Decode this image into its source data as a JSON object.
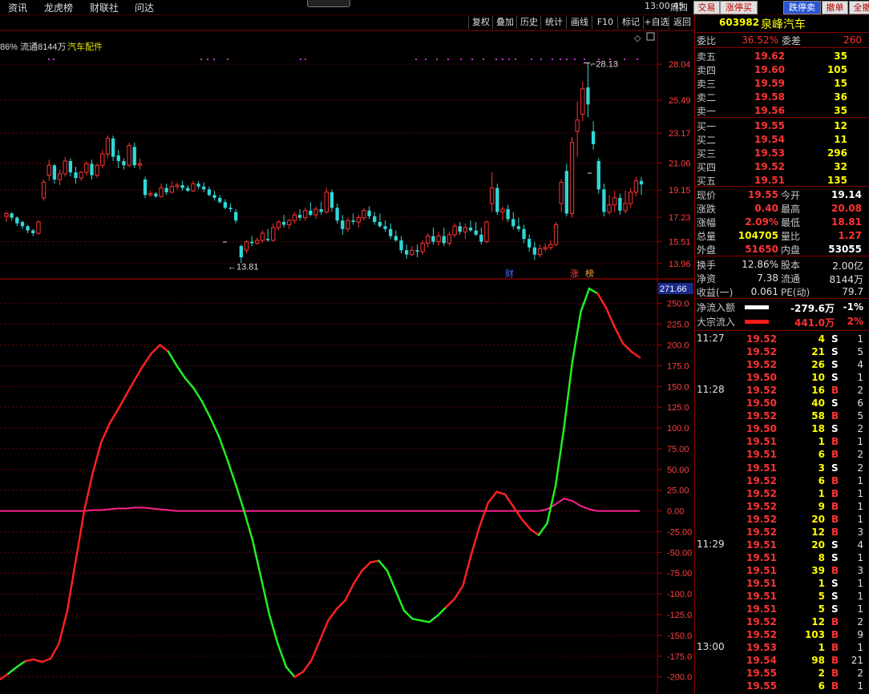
{
  "menu": [
    "资讯",
    "龙虎榜",
    "财联社",
    "问达"
  ],
  "clock": "13:00:45",
  "weekday": "周四",
  "top_buttons": [
    {
      "label": "交易",
      "bg": "#e0e0e0",
      "fg": "#c00000"
    },
    {
      "label": "涨停买",
      "bg": "#e0e0e0",
      "fg": "#c00000"
    },
    {
      "label": "跌停卖",
      "bg": "#2a55d4",
      "fg": "#ffffff"
    },
    {
      "label": "撤单",
      "bg": "#e0e0e0",
      "fg": "#c00000"
    },
    {
      "label": "全撤",
      "bg": "#e0e0e0",
      "fg": "#c00000"
    }
  ],
  "toolbar": [
    "复权",
    "叠加",
    "历史",
    "统计",
    "画线",
    "F10",
    "标记",
    "+自选",
    "返回"
  ],
  "chart_info": {
    "prefix": "86% 流通8144万",
    "sector": "汽车配件"
  },
  "price_axis": [
    "28.04",
    "25.49",
    "23.17",
    "21.06",
    "19.15",
    "17.23",
    "15.51",
    "13.96"
  ],
  "high_mark": "28.13",
  "low_mark": "13.81",
  "markers": [
    {
      "text": "财",
      "color": "#4a6cff"
    },
    {
      "text": "涨",
      "color": "#ff4040"
    },
    {
      "text": "榜",
      "color": "#ff9a30"
    }
  ],
  "indicator_current": "271.66",
  "indicator_axis": [
    "250.0",
    "225.0",
    "200.0",
    "175.0",
    "150.0",
    "125.0",
    "100.0",
    "75.00",
    "50.00",
    "25.00",
    "0.00",
    "-25.00",
    "-50.00",
    "-75.00",
    "-100.0",
    "-125.0",
    "-150.0",
    "-175.0",
    "-200.0"
  ],
  "colors": {
    "up": "#ff3333",
    "down": "#30d8d8",
    "green_line": "#22ee22",
    "red_line": "#ff2020",
    "zero_line": "#ff2090",
    "grid": "#6a0000",
    "yellow": "#ffff00"
  },
  "stock": {
    "code": "603982",
    "name": "泉峰汽车"
  },
  "weibi": {
    "label1": "委比",
    "val1": "36.52%",
    "label2": "委差",
    "val2": "260"
  },
  "asks": [
    {
      "label": "卖五",
      "price": "19.62",
      "vol": "35"
    },
    {
      "label": "卖四",
      "price": "19.60",
      "vol": "105"
    },
    {
      "label": "卖三",
      "price": "19.59",
      "vol": "15"
    },
    {
      "label": "卖二",
      "price": "19.58",
      "vol": "36"
    },
    {
      "label": "卖一",
      "price": "19.56",
      "vol": "35"
    }
  ],
  "bids": [
    {
      "label": "买一",
      "price": "19.55",
      "vol": "12"
    },
    {
      "label": "买二",
      "price": "19.54",
      "vol": "11"
    },
    {
      "label": "买三",
      "price": "19.53",
      "vol": "296"
    },
    {
      "label": "买四",
      "price": "19.52",
      "vol": "32"
    },
    {
      "label": "买五",
      "price": "19.51",
      "vol": "135"
    }
  ],
  "quote": [
    {
      "l1": "现价",
      "v1": "19.55",
      "c1": "#ff3333",
      "l2": "今开",
      "v2": "19.14",
      "c2": "#ffffff"
    },
    {
      "l1": "涨跌",
      "v1": "0.40",
      "c1": "#ff3333",
      "l2": "最高",
      "v2": "20.08",
      "c2": "#ff3333"
    },
    {
      "l1": "涨幅",
      "v1": "2.09%",
      "c1": "#ff3333",
      "l2": "最低",
      "v2": "18.81",
      "c2": "#ff3333"
    },
    {
      "l1": "总量",
      "v1": "104705",
      "c1": "#ffff00",
      "l2": "量比",
      "v2": "1.27",
      "c2": "#ff3333"
    },
    {
      "l1": "外盘",
      "v1": "51650",
      "c1": "#ff3333",
      "l2": "内盘",
      "v2": "53055",
      "c2": "#ffffff"
    }
  ],
  "stats": [
    {
      "l1": "换手",
      "v1": "12.86%",
      "l2": "股本",
      "v2": "2.00亿"
    },
    {
      "l1": "净资",
      "v1": "7.38",
      "l2": "流通",
      "v2": "8144万"
    },
    {
      "l1": "收益(一)",
      "v1": "0.061",
      "l2": "PE(动)",
      "v2": "79.7"
    }
  ],
  "flows": [
    {
      "label": "净流入额",
      "bar_color": "#ffffff",
      "value": "-279.6万",
      "pct": "-1%",
      "vcolor": "#ffffff"
    },
    {
      "label": "大宗流入",
      "bar_color": "#ff1a1a",
      "value": "441.0万",
      "pct": "2%",
      "vcolor": "#ff3333"
    }
  ],
  "ticks": [
    {
      "time": "11:27",
      "price": "19.52",
      "vol": "4",
      "bs": "S",
      "n": "1"
    },
    {
      "time": "",
      "price": "19.52",
      "vol": "21",
      "bs": "S",
      "n": "5"
    },
    {
      "time": "",
      "price": "19.52",
      "vol": "26",
      "bs": "S",
      "n": "4"
    },
    {
      "time": "",
      "price": "19.50",
      "vol": "10",
      "bs": "S",
      "n": "1"
    },
    {
      "time": "11:28",
      "price": "19.52",
      "vol": "16",
      "bs": "B",
      "n": "2"
    },
    {
      "time": "",
      "price": "19.50",
      "vol": "40",
      "bs": "S",
      "n": "6"
    },
    {
      "time": "",
      "price": "19.52",
      "vol": "58",
      "bs": "B",
      "n": "5"
    },
    {
      "time": "",
      "price": "19.50",
      "vol": "18",
      "bs": "S",
      "n": "2"
    },
    {
      "time": "",
      "price": "19.51",
      "vol": "1",
      "bs": "B",
      "n": "1"
    },
    {
      "time": "",
      "price": "19.51",
      "vol": "6",
      "bs": "B",
      "n": "2"
    },
    {
      "time": "",
      "price": "19.51",
      "vol": "3",
      "bs": "S",
      "n": "2"
    },
    {
      "time": "",
      "price": "19.52",
      "vol": "6",
      "bs": "B",
      "n": "1"
    },
    {
      "time": "",
      "price": "19.52",
      "vol": "1",
      "bs": "B",
      "n": "1"
    },
    {
      "time": "",
      "price": "19.52",
      "vol": "9",
      "bs": "B",
      "n": "1"
    },
    {
      "time": "",
      "price": "19.52",
      "vol": "20",
      "bs": "B",
      "n": "1"
    },
    {
      "time": "",
      "price": "19.52",
      "vol": "12",
      "bs": "B",
      "n": "3"
    },
    {
      "time": "11:29",
      "price": "19.51",
      "vol": "20",
      "bs": "S",
      "n": "4"
    },
    {
      "time": "",
      "price": "19.51",
      "vol": "8",
      "bs": "S",
      "n": "1"
    },
    {
      "time": "",
      "price": "19.51",
      "vol": "39",
      "bs": "B",
      "n": "3"
    },
    {
      "time": "",
      "price": "19.51",
      "vol": "1",
      "bs": "S",
      "n": "1"
    },
    {
      "time": "",
      "price": "19.51",
      "vol": "5",
      "bs": "S",
      "n": "1"
    },
    {
      "time": "",
      "price": "19.51",
      "vol": "5",
      "bs": "S",
      "n": "1"
    },
    {
      "time": "",
      "price": "19.52",
      "vol": "12",
      "bs": "B",
      "n": "2"
    },
    {
      "time": "",
      "price": "19.52",
      "vol": "103",
      "bs": "B",
      "n": "9"
    },
    {
      "time": "13:00",
      "price": "19.53",
      "vol": "1",
      "bs": "B",
      "n": "1"
    },
    {
      "time": "",
      "price": "19.54",
      "vol": "98",
      "bs": "B",
      "n": "21"
    },
    {
      "time": "",
      "price": "19.55",
      "vol": "2",
      "bs": "B",
      "n": "2"
    },
    {
      "time": "",
      "price": "19.55",
      "vol": "6",
      "bs": "B",
      "n": "1"
    }
  ],
  "chart_data": [
    {
      "type": "candlestick",
      "ylim": [
        13.5,
        28.5
      ],
      "candles": [
        [
          17.3,
          17.6,
          16.9,
          17.5
        ],
        [
          17.5,
          17.6,
          17.0,
          17.2
        ],
        [
          17.2,
          17.3,
          16.6,
          16.8
        ],
        [
          16.9,
          17.0,
          16.4,
          16.6
        ],
        [
          16.6,
          16.7,
          16.1,
          16.3
        ],
        [
          16.3,
          16.4,
          15.9,
          16.1
        ],
        [
          16.1,
          17.0,
          16.0,
          16.9
        ],
        [
          18.6,
          19.9,
          18.4,
          19.7
        ],
        [
          20.2,
          21.3,
          19.8,
          20.9
        ],
        [
          20.9,
          21.0,
          19.6,
          19.9
        ],
        [
          19.9,
          20.6,
          19.5,
          20.3
        ],
        [
          20.3,
          21.5,
          20.1,
          21.2
        ],
        [
          21.2,
          21.4,
          20.1,
          20.4
        ],
        [
          20.4,
          20.8,
          19.6,
          20.0
        ],
        [
          20.0,
          20.5,
          19.8,
          20.4
        ],
        [
          20.4,
          21.2,
          20.2,
          21.0
        ],
        [
          21.0,
          21.3,
          19.9,
          20.2
        ],
        [
          20.2,
          21.0,
          20.0,
          20.9
        ],
        [
          20.9,
          22.0,
          20.7,
          21.7
        ],
        [
          21.7,
          23.0,
          21.4,
          22.8
        ],
        [
          22.8,
          23.0,
          21.2,
          21.5
        ],
        [
          21.6,
          22.0,
          20.7,
          21.2
        ],
        [
          21.2,
          21.4,
          20.6,
          20.9
        ],
        [
          20.9,
          22.5,
          20.8,
          22.3
        ],
        [
          22.2,
          22.5,
          20.7,
          20.9
        ],
        [
          20.9,
          21.4,
          20.6,
          21.0
        ],
        [
          19.9,
          20.1,
          18.6,
          18.8
        ],
        [
          18.8,
          19.1,
          18.7,
          18.9
        ],
        [
          18.9,
          19.0,
          18.6,
          18.7
        ],
        [
          18.7,
          19.6,
          18.6,
          19.3
        ],
        [
          19.3,
          19.6,
          18.8,
          19.0
        ],
        [
          19.0,
          19.8,
          18.9,
          19.4
        ],
        [
          19.4,
          19.7,
          19.2,
          19.5
        ],
        [
          19.5,
          19.8,
          19.1,
          19.3
        ],
        [
          19.3,
          19.5,
          19.0,
          19.1
        ],
        [
          19.1,
          19.8,
          19.0,
          19.6
        ],
        [
          19.6,
          19.8,
          19.2,
          19.4
        ],
        [
          19.4,
          19.7,
          19.0,
          19.2
        ],
        [
          19.2,
          19.4,
          18.7,
          18.8
        ],
        [
          18.8,
          19.1,
          18.4,
          18.6
        ],
        [
          18.6,
          18.8,
          18.2,
          18.3
        ],
        [
          18.3,
          18.5,
          17.8,
          17.9
        ],
        [
          17.9,
          18.2,
          17.6,
          17.8
        ],
        [
          17.6,
          17.8,
          16.8,
          17.0
        ],
        [
          15.2,
          15.3,
          14.0,
          14.4
        ],
        [
          14.9,
          15.6,
          14.7,
          15.5
        ],
        [
          15.5,
          15.9,
          15.2,
          15.4
        ],
        [
          15.4,
          15.8,
          15.3,
          15.6
        ],
        [
          15.6,
          16.3,
          15.4,
          16.1
        ],
        [
          15.7,
          16.4,
          15.5,
          15.6
        ],
        [
          15.6,
          16.8,
          15.5,
          16.5
        ],
        [
          16.5,
          17.0,
          16.3,
          16.9
        ],
        [
          16.9,
          17.4,
          16.5,
          16.7
        ],
        [
          16.7,
          17.1,
          16.4,
          17.0
        ],
        [
          17.0,
          17.6,
          16.8,
          17.4
        ],
        [
          17.4,
          17.8,
          17.0,
          17.2
        ],
        [
          17.2,
          17.9,
          17.0,
          17.7
        ],
        [
          17.7,
          18.3,
          17.3,
          17.4
        ],
        [
          17.4,
          18.0,
          17.1,
          17.8
        ],
        [
          17.8,
          18.3,
          17.4,
          17.6
        ],
        [
          17.6,
          19.3,
          17.5,
          19.0
        ],
        [
          19.0,
          19.2,
          17.6,
          17.9
        ],
        [
          17.9,
          18.2,
          16.8,
          17.0
        ],
        [
          17.0,
          17.4,
          16.0,
          16.4
        ],
        [
          16.4,
          17.2,
          16.2,
          17.0
        ],
        [
          17.0,
          17.5,
          16.7,
          16.9
        ],
        [
          16.9,
          17.4,
          16.5,
          17.2
        ],
        [
          17.2,
          17.9,
          17.0,
          17.7
        ],
        [
          17.7,
          18.0,
          17.1,
          17.3
        ],
        [
          17.3,
          17.6,
          16.7,
          16.9
        ],
        [
          16.9,
          17.5,
          16.5,
          16.6
        ],
        [
          16.6,
          17.0,
          16.2,
          16.4
        ],
        [
          16.4,
          16.8,
          15.7,
          15.9
        ],
        [
          15.9,
          16.3,
          15.5,
          15.6
        ],
        [
          15.6,
          15.9,
          14.7,
          14.9
        ],
        [
          14.9,
          15.3,
          14.3,
          14.6
        ],
        [
          14.6,
          15.2,
          14.5,
          14.9
        ],
        [
          14.9,
          15.3,
          14.4,
          14.8
        ],
        [
          14.8,
          15.6,
          14.6,
          15.4
        ],
        [
          15.4,
          16.1,
          15.1,
          15.9
        ],
        [
          15.9,
          16.5,
          15.3,
          15.5
        ],
        [
          15.5,
          16.2,
          15.2,
          15.9
        ],
        [
          15.9,
          16.5,
          15.2,
          15.4
        ],
        [
          15.4,
          16.2,
          15.2,
          16.0
        ],
        [
          16.0,
          16.8,
          15.8,
          16.6
        ],
        [
          16.6,
          16.9,
          16.0,
          16.2
        ],
        [
          16.2,
          16.8,
          15.7,
          16.5
        ],
        [
          16.5,
          17.0,
          16.2,
          16.3
        ],
        [
          16.3,
          16.9,
          15.9,
          16.0
        ],
        [
          16.0,
          16.5,
          15.3,
          15.5
        ],
        [
          15.5,
          17.0,
          15.4,
          16.9
        ],
        [
          18.2,
          20.4,
          17.6,
          19.3
        ],
        [
          19.3,
          19.6,
          17.4,
          17.6
        ],
        [
          17.6,
          18.0,
          17.0,
          17.8
        ],
        [
          17.8,
          18.1,
          16.9,
          17.1
        ],
        [
          17.1,
          17.6,
          16.4,
          16.6
        ],
        [
          16.6,
          17.2,
          16.2,
          16.4
        ],
        [
          16.4,
          16.7,
          15.4,
          15.7
        ],
        [
          15.7,
          16.0,
          14.8,
          15.1
        ],
        [
          15.1,
          15.5,
          14.2,
          14.6
        ],
        [
          14.6,
          15.3,
          14.4,
          15.0
        ],
        [
          15.0,
          15.4,
          14.8,
          15.1
        ],
        [
          15.1,
          15.6,
          14.9,
          15.3
        ],
        [
          15.3,
          16.9,
          15.2,
          16.7
        ],
        [
          18.2,
          19.9,
          17.6,
          19.7
        ],
        [
          20.5,
          21.0,
          17.3,
          17.5
        ],
        [
          17.5,
          22.9,
          17.2,
          22.5
        ],
        [
          23.3,
          25.4,
          21.5,
          24.1
        ],
        [
          24.5,
          26.8,
          24.0,
          26.3
        ],
        [
          26.4,
          28.13,
          24.3,
          25.2
        ],
        [
          23.3,
          24.0,
          22.0,
          22.4
        ],
        [
          21.2,
          21.4,
          18.9,
          19.2
        ],
        [
          19.2,
          19.6,
          17.3,
          17.6
        ],
        [
          17.6,
          18.8,
          17.4,
          18.1
        ],
        [
          18.1,
          19.1,
          17.6,
          18.6
        ],
        [
          18.6,
          18.9,
          17.4,
          17.7
        ],
        [
          17.7,
          19.1,
          17.5,
          18.2
        ],
        [
          18.2,
          19.3,
          17.9,
          19.0
        ],
        [
          19.0,
          20.1,
          18.7,
          19.8
        ],
        [
          19.8,
          20.08,
          18.81,
          19.55
        ]
      ]
    },
    {
      "type": "line",
      "ylim": [
        -210,
        270
      ],
      "main_series": [
        -203,
        -196,
        -188,
        -181,
        -179,
        -182,
        -178,
        -160,
        -120,
        -60,
        0,
        45,
        82,
        105,
        122,
        140,
        158,
        175,
        190,
        200,
        192,
        175,
        160,
        148,
        132,
        112,
        90,
        62,
        32,
        0,
        -35,
        -80,
        -125,
        -160,
        -188,
        -200,
        -194,
        -180,
        -156,
        -132,
        -118,
        -108,
        -88,
        -72,
        -62,
        -60,
        -72,
        -96,
        -120,
        -130,
        -132,
        -134,
        -126,
        -116,
        -106,
        -90,
        -52,
        -18,
        10,
        23,
        20,
        5,
        -10,
        -22,
        -29,
        -15,
        30,
        100,
        180,
        240,
        268,
        262,
        245,
        222,
        202,
        192,
        185
      ],
      "main_colors": "rggrrrrrrrrrrrrrrrrrgggggggggggggggrrrrrrrrrrggggggggrrrrrrrrrrrgggggggrrrrrrrrgggggg",
      "zero_series": [
        0,
        0,
        0,
        0,
        0,
        0,
        0,
        0,
        0,
        0,
        0,
        1,
        1,
        2,
        3,
        3,
        4,
        4,
        3,
        2,
        1,
        0,
        0,
        0,
        0,
        0,
        0,
        0,
        0,
        0,
        0,
        0,
        0,
        0,
        0,
        0,
        0,
        0,
        0,
        0,
        0,
        0,
        0,
        0,
        0,
        0,
        0,
        0,
        0,
        0,
        0,
        0,
        0,
        0,
        0,
        0,
        0,
        0,
        0,
        0,
        0,
        0,
        0,
        0,
        0,
        2,
        8,
        15,
        12,
        6,
        2,
        0,
        0,
        0,
        0,
        0,
        0
      ]
    }
  ]
}
